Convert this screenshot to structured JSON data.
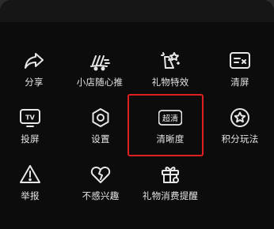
{
  "menu": {
    "items": [
      {
        "label": "分享",
        "icon": "share-icon"
      },
      {
        "label": "小店随心推",
        "icon": "promote-icon"
      },
      {
        "label": "礼物特效",
        "icon": "gift-effect-icon"
      },
      {
        "label": "清屏",
        "icon": "clear-screen-icon"
      },
      {
        "label": "投屏",
        "icon": "cast-tv-icon"
      },
      {
        "label": "设置",
        "icon": "settings-icon"
      },
      {
        "label": "清晰度",
        "icon": "definition-icon",
        "badge": "超清"
      },
      {
        "label": "积分玩法",
        "icon": "points-icon"
      },
      {
        "label": "举报",
        "icon": "report-icon"
      },
      {
        "label": "不感兴趣",
        "icon": "not-interested-icon"
      },
      {
        "label": "礼物消费提醒",
        "icon": "gift-reminder-icon"
      }
    ]
  },
  "tv_text": "TV",
  "colors": {
    "background": "#0c0c0c",
    "icon": "#e6e6e6",
    "highlight": "#e02020"
  }
}
